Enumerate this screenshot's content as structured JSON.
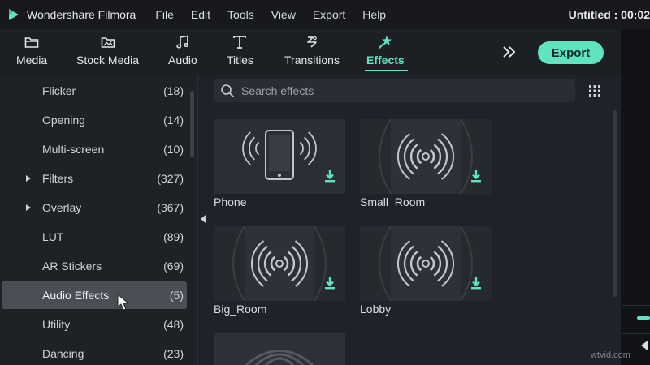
{
  "app": {
    "name": "Wondershare Filmora",
    "title_right": "Untitled : 00:02"
  },
  "menus": [
    "File",
    "Edit",
    "Tools",
    "View",
    "Export",
    "Help"
  ],
  "toolbar": {
    "tabs": [
      {
        "label": "Media",
        "icon": "folder-icon"
      },
      {
        "label": "Stock Media",
        "icon": "stock-media-icon"
      },
      {
        "label": "Audio",
        "icon": "music-note-icon"
      },
      {
        "label": "Titles",
        "icon": "text-t-icon"
      },
      {
        "label": "Transitions",
        "icon": "transitions-icon"
      },
      {
        "label": "Effects",
        "icon": "effects-star-icon",
        "active": true
      }
    ],
    "export_label": "Export"
  },
  "sidebar": {
    "items": [
      {
        "label": "Flicker",
        "count": "(18)",
        "expandable": false
      },
      {
        "label": "Opening",
        "count": "(14)",
        "expandable": false
      },
      {
        "label": "Multi-screen",
        "count": "(10)",
        "expandable": false
      },
      {
        "label": "Filters",
        "count": "(327)",
        "expandable": true
      },
      {
        "label": "Overlay",
        "count": "(367)",
        "expandable": true
      },
      {
        "label": "LUT",
        "count": "(89)",
        "expandable": false
      },
      {
        "label": "AR Stickers",
        "count": "(69)",
        "expandable": false
      },
      {
        "label": "Audio Effects",
        "count": "(5)",
        "expandable": false,
        "selected": true
      },
      {
        "label": "Utility",
        "count": "(48)",
        "expandable": false
      },
      {
        "label": "Dancing",
        "count": "(23)",
        "expandable": false
      }
    ]
  },
  "search": {
    "placeholder": "Search effects"
  },
  "effects": [
    {
      "name": "Phone",
      "art": "phone"
    },
    {
      "name": "Small_Room",
      "art": "waves"
    },
    {
      "name": "Big_Room",
      "art": "waves"
    },
    {
      "name": "Lobby",
      "art": "waves"
    }
  ],
  "colors": {
    "accent": "#5fe3c1",
    "background": "#1f2228",
    "menubar": "#17191d",
    "selected": "#4a4e55"
  },
  "watermark": "wtvid.com"
}
